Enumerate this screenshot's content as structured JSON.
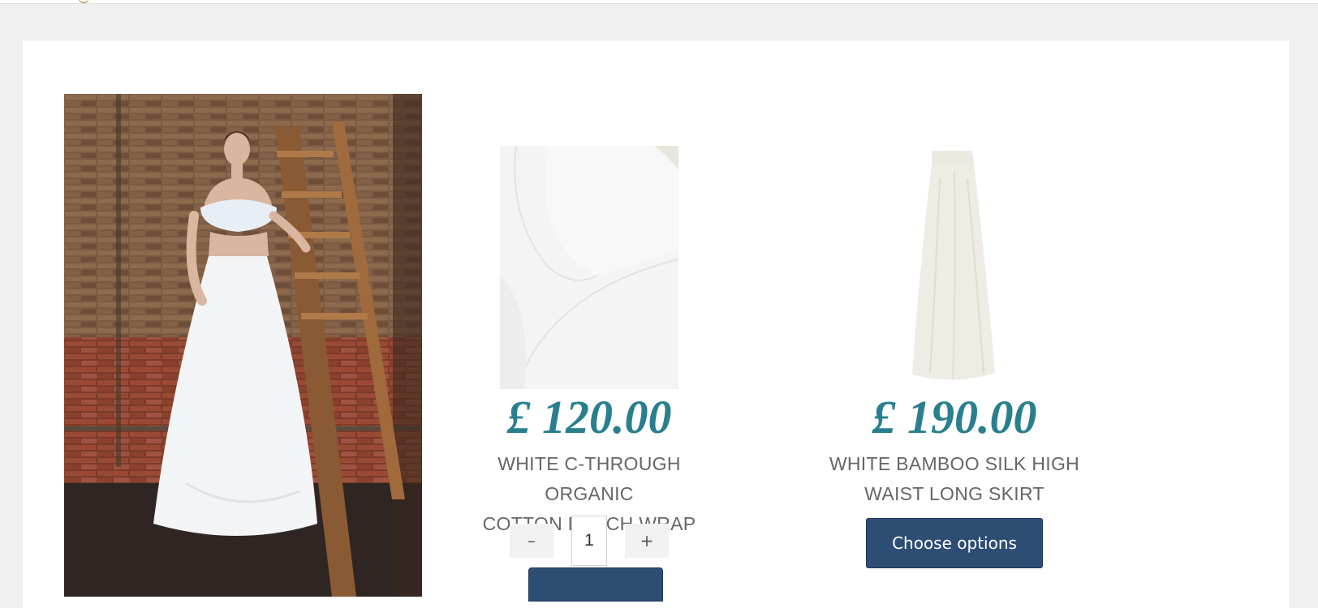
{
  "colors": {
    "price": "#2a7f8f",
    "button_bg": "#2e4d75",
    "product_name": "#666666",
    "page_bg": "#f0f0f0"
  },
  "hero": {
    "image_name": "model-wearing-white-top-and-skirt"
  },
  "products": [
    {
      "price": "£ 120.00",
      "name_line1": "WHITE C-THROUGH ORGANIC",
      "name_line2": "COTTON BEACH WRAP",
      "quantity": {
        "minus_label": "–",
        "value": "1",
        "plus_label": "+"
      },
      "image_name": "white-cotton-beach-wrap-image"
    },
    {
      "price": "£ 190.00",
      "name_line1": "WHITE BAMBOO SILK HIGH",
      "name_line2": "WAIST LONG SKIRT",
      "button_label": "Choose options",
      "image_name": "white-long-skirt-image"
    }
  ]
}
